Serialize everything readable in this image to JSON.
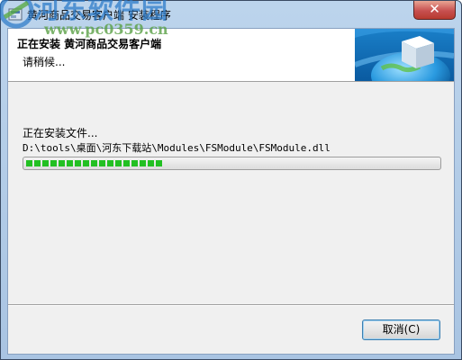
{
  "window": {
    "title": "黄河商品交易客户端 安装程序",
    "close_glyph": "✕"
  },
  "header": {
    "title": "正在安装 黄河商品交易客户端",
    "subtitle": "请稍候..."
  },
  "watermark": {
    "text": "河东软件园",
    "url": "www.pc0359.cn"
  },
  "install": {
    "status": "正在安装文件...",
    "file_path": "D:\\tools\\桌面\\河东下载站\\Modules\\FSModule\\FSModule.dll",
    "progress": 0.33
  },
  "buttons": {
    "cancel": "取消(C)"
  },
  "colors": {
    "progress_fill": "#22c022",
    "close_button": "#c75050"
  },
  "icons": {
    "app": "installer-app-icon",
    "header": "globe-box-icon",
    "close": "close-icon"
  }
}
